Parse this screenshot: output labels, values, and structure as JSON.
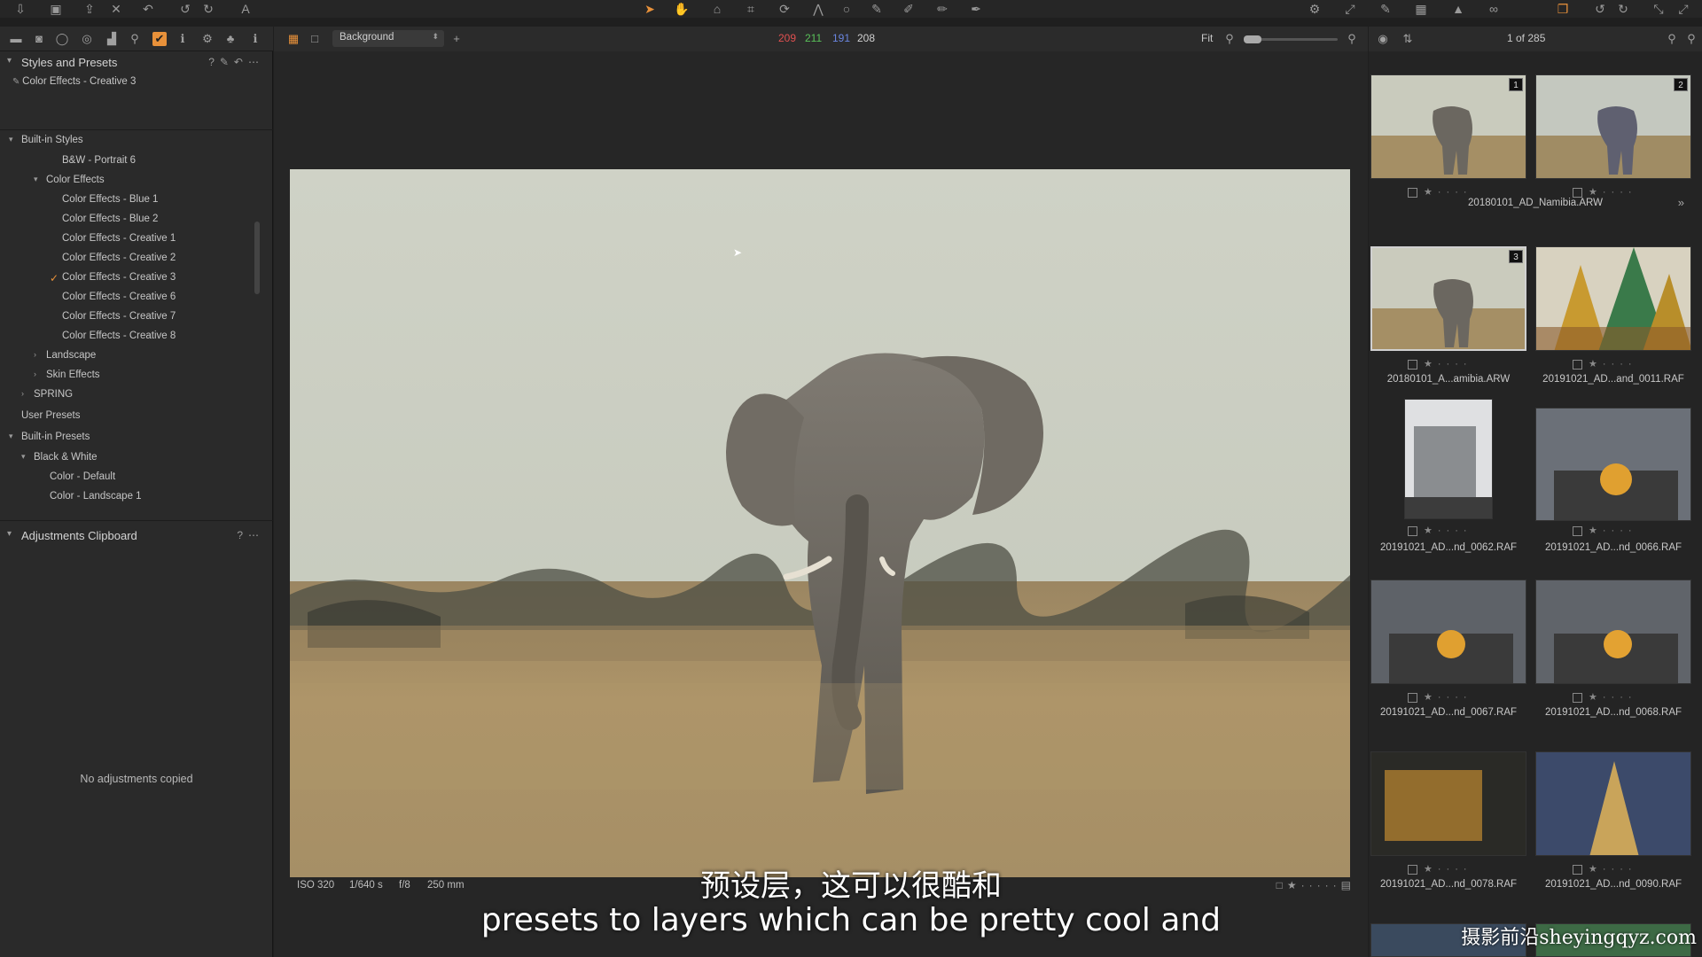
{
  "viewer": {
    "background_label": "Background",
    "rgb": {
      "r": "209",
      "g": "211",
      "b": "191",
      "l": "208"
    },
    "zoom_label": "Fit",
    "metadata": {
      "iso": "ISO 320",
      "shutter": "1/640 s",
      "aperture": "f/8",
      "focal": "250 mm"
    }
  },
  "left": {
    "styles_title": "Styles and Presets",
    "applied": "Color Effects - Creative 3",
    "tree": [
      {
        "label": "Built-in Styles",
        "chev": "v"
      },
      {
        "label": "B&W - Portrait 6"
      },
      {
        "label": "Color Effects",
        "chev": "v"
      },
      {
        "label": "Color Effects - Blue 1"
      },
      {
        "label": "Color Effects - Blue 2"
      },
      {
        "label": "Color Effects - Creative 1"
      },
      {
        "label": "Color Effects - Creative 2"
      },
      {
        "label": "Color Effects - Creative 3",
        "checked": true
      },
      {
        "label": "Color Effects - Creative 6"
      },
      {
        "label": "Color Effects - Creative 7"
      },
      {
        "label": "Color Effects - Creative 8"
      },
      {
        "label": "Landscape",
        "chev": ">"
      },
      {
        "label": "Skin Effects",
        "chev": ">"
      },
      {
        "label": "SPRING",
        "chev": ">"
      },
      {
        "label": "User Presets"
      },
      {
        "label": "Built-in Presets",
        "chev": "v"
      },
      {
        "label": "Black & White",
        "chev": "v"
      },
      {
        "label": "Color - Default"
      },
      {
        "label": "Color - Landscape 1"
      }
    ],
    "clipboard_title": "Adjustments Clipboard",
    "clipboard_empty": "No adjustments copied"
  },
  "browser": {
    "count": "1 of 285",
    "group_name": "20180101_AD_Namibia.ARW",
    "thumbs": [
      {
        "name": "",
        "badge": "1"
      },
      {
        "name": "",
        "badge": "2"
      },
      {
        "name": "20180101_A...amibia.ARW",
        "badge": "3"
      },
      {
        "name": "20191021_AD...and_0011.RAF"
      },
      {
        "name": "20191021_AD...nd_0062.RAF"
      },
      {
        "name": "20191021_AD...nd_0066.RAF"
      },
      {
        "name": "20191021_AD...nd_0067.RAF"
      },
      {
        "name": "20191021_AD...nd_0068.RAF"
      },
      {
        "name": "20191021_AD...nd_0078.RAF"
      },
      {
        "name": "20191021_AD...nd_0090.RAF"
      }
    ]
  },
  "subtitles": {
    "cn": "预设层，这可以很酷和",
    "en": "presets to layers which can be pretty cool and"
  },
  "watermark": "摄影前沿sheyingqyz.com",
  "colors": {
    "accent": "#e8913a",
    "panel": "#2a2a2a",
    "viewer": "#262626"
  }
}
